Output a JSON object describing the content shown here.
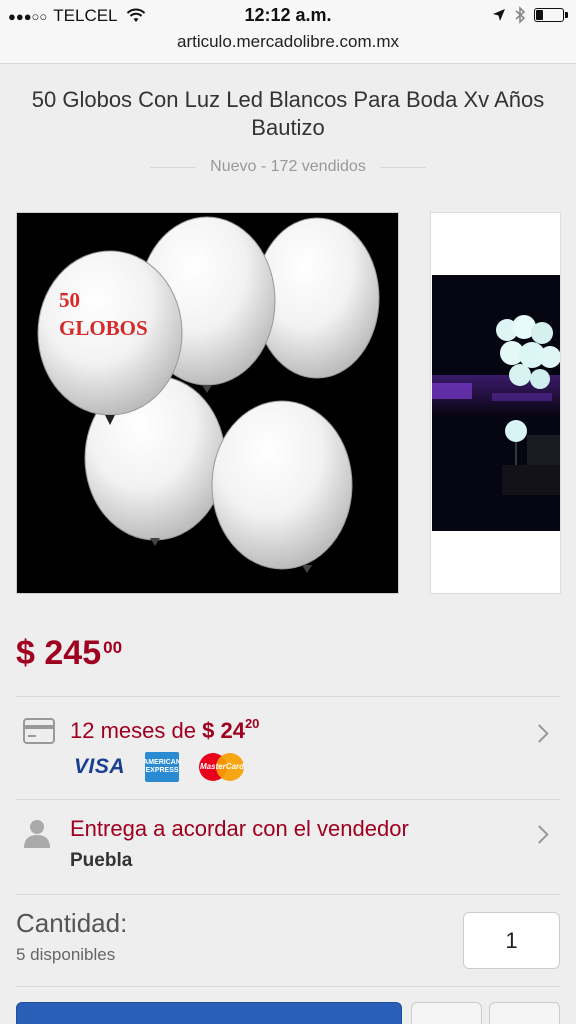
{
  "status_bar": {
    "signal_dots": "●●●○○",
    "carrier": "TELCEL",
    "time": "12:12 a.m.",
    "icons": [
      "wifi-icon",
      "location-arrow-icon",
      "bluetooth-icon",
      "battery-icon"
    ],
    "battery_level": 0.25
  },
  "browser": {
    "url": "articulo.mercadolibre.com.mx"
  },
  "product": {
    "title": "50 Globos Con Luz Led Blancos Para Boda Xv Años Bautizo",
    "condition_sales": "Nuevo - 172 vendidos",
    "image_text": {
      "line1": "50",
      "line2": "GLOBOS"
    },
    "price": {
      "currency": "$",
      "integer": "245",
      "cents": "00"
    }
  },
  "installments": {
    "prefix": "12 meses de",
    "currency": "$",
    "integer": "24",
    "cents": "20",
    "cards": {
      "visa": "VISA",
      "amex": "AMERICAN EXPRESS",
      "mastercard": "MasterCard"
    }
  },
  "delivery": {
    "text": "Entrega a acordar con el vendedor",
    "location": "Puebla"
  },
  "quantity": {
    "label": "Cantidad:",
    "available": "5 disponibles",
    "value": "1"
  },
  "colors": {
    "accent": "#a0001f",
    "primary_button": "#2a5fb8",
    "background": "#eeeeee"
  }
}
